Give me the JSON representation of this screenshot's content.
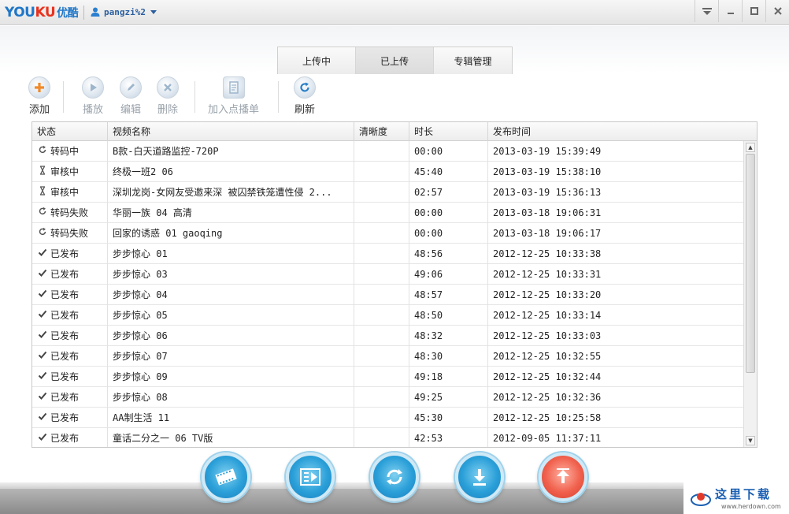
{
  "app": {
    "logo_you": "YOU",
    "logo_ku": "KU",
    "logo_cn": "优酷",
    "username": "pangzi%2",
    "window_buttons": [
      "menu",
      "minimize",
      "maximize",
      "close"
    ]
  },
  "tabs": [
    {
      "label": "上传中",
      "active": false
    },
    {
      "label": "已上传",
      "active": true
    },
    {
      "label": "专辑管理",
      "active": false
    }
  ],
  "toolbar": {
    "add": "添加",
    "play": "播放",
    "edit": "编辑",
    "delete": "删除",
    "add_playlist": "加入点播单",
    "refresh": "刷新"
  },
  "table": {
    "headers": [
      "状态",
      "视频名称",
      "清晰度",
      "时长",
      "发布时间"
    ],
    "rows": [
      {
        "icon": "sync-icon",
        "status": "转码中",
        "name": "B款-白天道路监控-720P",
        "quality": "",
        "duration": "00:00",
        "time": "2013-03-19 15:39:49"
      },
      {
        "icon": "hourglass-icon",
        "status": "审核中",
        "name": "终极一班2 06",
        "quality": "",
        "duration": "45:40",
        "time": "2013-03-19 15:38:10"
      },
      {
        "icon": "hourglass-icon",
        "status": "审核中",
        "name": "深圳龙岗-女网友受邀来深 被囚禁铁笼遭性侵 2...",
        "quality": "",
        "duration": "02:57",
        "time": "2013-03-19 15:36:13"
      },
      {
        "icon": "sync-icon",
        "status": "转码失败",
        "name": "华丽一族 04 高清",
        "quality": "",
        "duration": "00:00",
        "time": "2013-03-18 19:06:31"
      },
      {
        "icon": "sync-icon",
        "status": "转码失败",
        "name": "回家的诱惑 01 gaoqing",
        "quality": "",
        "duration": "00:00",
        "time": "2013-03-18 19:06:17"
      },
      {
        "icon": "check-icon",
        "status": "已发布",
        "name": "步步惊心 01",
        "quality": "",
        "duration": "48:56",
        "time": "2012-12-25 10:33:38"
      },
      {
        "icon": "check-icon",
        "status": "已发布",
        "name": "步步惊心 03",
        "quality": "",
        "duration": "49:06",
        "time": "2012-12-25 10:33:31"
      },
      {
        "icon": "check-icon",
        "status": "已发布",
        "name": "步步惊心 04",
        "quality": "",
        "duration": "48:57",
        "time": "2012-12-25 10:33:20"
      },
      {
        "icon": "check-icon",
        "status": "已发布",
        "name": "步步惊心 05",
        "quality": "",
        "duration": "48:50",
        "time": "2012-12-25 10:33:14"
      },
      {
        "icon": "check-icon",
        "status": "已发布",
        "name": "步步惊心 06",
        "quality": "",
        "duration": "48:32",
        "time": "2012-12-25 10:33:03"
      },
      {
        "icon": "check-icon",
        "status": "已发布",
        "name": "步步惊心 07",
        "quality": "",
        "duration": "48:30",
        "time": "2012-12-25 10:32:55"
      },
      {
        "icon": "check-icon",
        "status": "已发布",
        "name": "步步惊心 09",
        "quality": "",
        "duration": "49:18",
        "time": "2012-12-25 10:32:44"
      },
      {
        "icon": "check-icon",
        "status": "已发布",
        "name": "步步惊心 08",
        "quality": "",
        "duration": "49:25",
        "time": "2012-12-25 10:32:36"
      },
      {
        "icon": "check-icon",
        "status": "已发布",
        "name": "AA制生活 11",
        "quality": "",
        "duration": "45:30",
        "time": "2012-12-25 10:25:58"
      },
      {
        "icon": "check-icon",
        "status": "已发布",
        "name": "童话二分之一 06 TV版",
        "quality": "",
        "duration": "42:53",
        "time": "2012-09-05 11:37:11"
      }
    ]
  },
  "bottom_buttons": [
    {
      "icon": "film-icon",
      "color": "blue"
    },
    {
      "icon": "playlist-icon",
      "color": "blue"
    },
    {
      "icon": "transcode-icon",
      "color": "blue"
    },
    {
      "icon": "download-icon",
      "color": "blue"
    },
    {
      "icon": "upload-icon",
      "color": "red"
    }
  ],
  "watermark": {
    "main": "这里下载",
    "sub": "www.herdown.com"
  },
  "colors": {
    "accent_blue": "#2a9fd8",
    "upload_red": "#f0614d",
    "brand_blue": "#2077c8",
    "brand_red": "#e8321e"
  }
}
